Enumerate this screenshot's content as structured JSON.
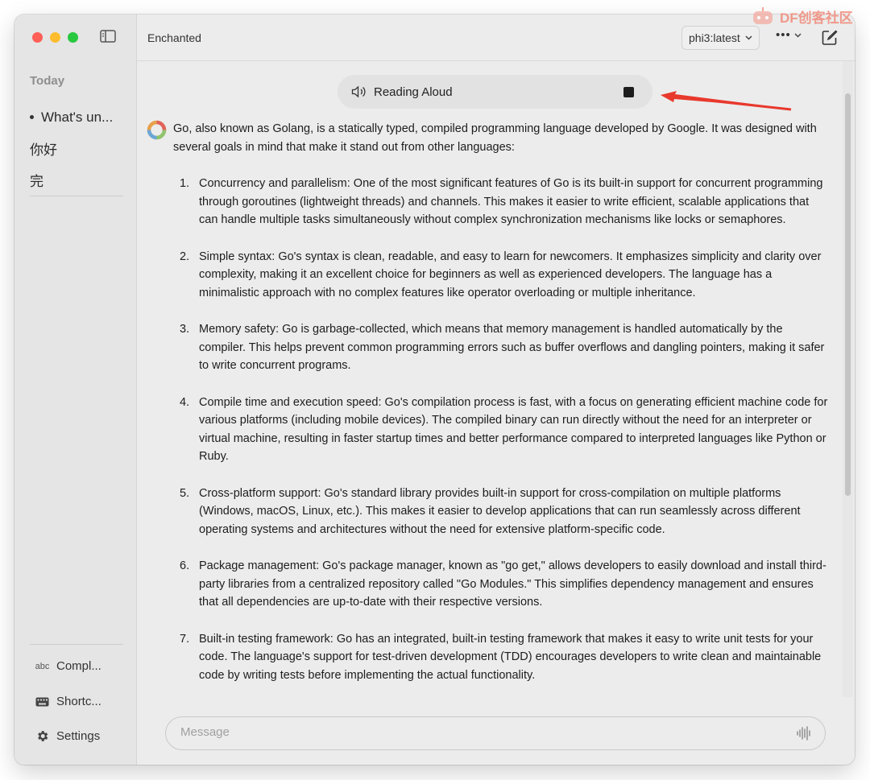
{
  "window": {
    "app_title": "Enchanted",
    "model": "phi3:latest",
    "more_label": "•••"
  },
  "sidebar": {
    "section_label": "Today",
    "chats": [
      {
        "label": "What's un...",
        "active": true
      },
      {
        "label": "你好",
        "active": false
      },
      {
        "label": "完",
        "active": false
      }
    ],
    "bottom": [
      {
        "icon": "abc-icon",
        "label": "Compl..."
      },
      {
        "icon": "keyboard-icon",
        "label": "Shortc..."
      },
      {
        "icon": "gear-icon",
        "label": "Settings"
      }
    ]
  },
  "reading": {
    "label": "Reading Aloud"
  },
  "message": {
    "intro": "Go, also known as Golang, is a statically typed, compiled programming language developed by Google. It was designed with several goals in mind that make it stand out from other languages:",
    "items": [
      {
        "num": "1.",
        "text": "Concurrency and parallelism: One of the most significant features of Go is its built-in support for concurrent programming through goroutines (lightweight threads) and channels. This makes it easier to write efficient, scalable applications that can handle multiple tasks simultaneously without complex synchronization mechanisms like locks or semaphores."
      },
      {
        "num": "2.",
        "text": "Simple syntax: Go's syntax is clean, readable, and easy to learn for newcomers. It emphasizes simplicity and clarity over complexity, making it an excellent choice for beginners as well as experienced developers. The language has a minimalistic approach with no complex features like operator overloading or multiple inheritance."
      },
      {
        "num": "3.",
        "text": "Memory safety: Go is garbage-collected, which means that memory management is handled automatically by the compiler. This helps prevent common programming errors such as buffer overflows and dangling pointers, making it safer to write concurrent programs."
      },
      {
        "num": "4.",
        "text": "Compile time and execution speed: Go's compilation process is fast, with a focus on generating efficient machine code for various platforms (including mobile devices). The compiled binary can run directly without the need for an interpreter or virtual machine, resulting in faster startup times and better performance compared to interpreted languages like Python or Ruby."
      },
      {
        "num": "5.",
        "text": "Cross-platform support: Go's standard library provides built-in support for cross-compilation on multiple platforms (Windows, macOS, Linux, etc.). This makes it easier to develop applications that can run seamlessly across different operating systems and architectures without the need for extensive platform-specific code."
      },
      {
        "num": "6.",
        "text": "Package management: Go's package manager, known as \"go get,\" allows developers to easily download and install third-party libraries from a centralized repository called \"Go Modules.\" This simplifies dependency management and ensures that all dependencies are up-to-date with their respective versions."
      },
      {
        "num": "7.",
        "text": "Built-in testing framework: Go has an integrated, built-in testing framework that makes it easy to write unit tests for your code. The language's support for test-driven development (TDD) encourages developers to write clean and maintainable code by writing tests before implementing the actual functionality."
      }
    ]
  },
  "composer": {
    "placeholder": "Message"
  },
  "watermark": {
    "text": "DF创客社区"
  },
  "colors": {
    "annotation_arrow": "#e8392d",
    "traffic_red": "#ff5f57",
    "traffic_yellow": "#febc2e",
    "traffic_green": "#28c840"
  }
}
